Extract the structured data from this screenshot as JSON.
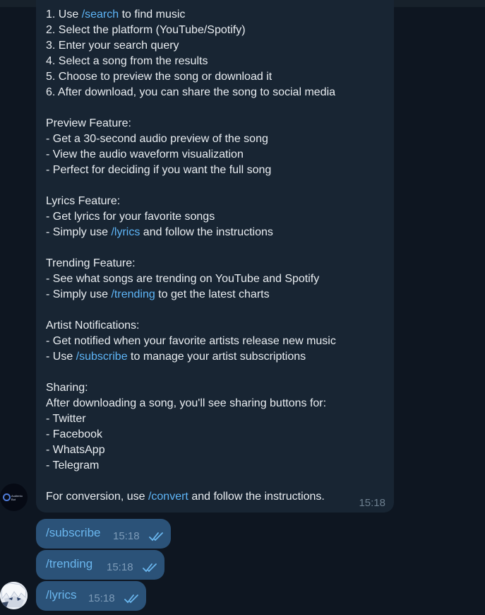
{
  "bot_message": {
    "lines": [
      {
        "type": "text",
        "parts": [
          {
            "t": "1. Use "
          },
          {
            "t": "/search",
            "cmd": true
          },
          {
            "t": " to find music"
          }
        ]
      },
      {
        "type": "text",
        "parts": [
          {
            "t": "2. Select the platform (YouTube/Spotify)"
          }
        ]
      },
      {
        "type": "text",
        "parts": [
          {
            "t": "3. Enter your search query"
          }
        ]
      },
      {
        "type": "text",
        "parts": [
          {
            "t": "4. Select a song from the results"
          }
        ]
      },
      {
        "type": "text",
        "parts": [
          {
            "t": "5. Choose to preview the song or download it"
          }
        ]
      },
      {
        "type": "text",
        "parts": [
          {
            "t": "6. After download, you can share the song to social media"
          }
        ]
      },
      {
        "type": "gap"
      },
      {
        "type": "heading",
        "parts": [
          {
            "t": "Preview Feature:"
          }
        ]
      },
      {
        "type": "text",
        "parts": [
          {
            "t": "- Get a 30-second audio preview of the song"
          }
        ]
      },
      {
        "type": "text",
        "parts": [
          {
            "t": "- View the audio waveform visualization"
          }
        ]
      },
      {
        "type": "text",
        "parts": [
          {
            "t": "- Perfect for deciding if you want the full song"
          }
        ]
      },
      {
        "type": "gap"
      },
      {
        "type": "heading",
        "parts": [
          {
            "t": "Lyrics Feature:"
          }
        ]
      },
      {
        "type": "text",
        "parts": [
          {
            "t": "- Get lyrics for your favorite songs"
          }
        ]
      },
      {
        "type": "text",
        "parts": [
          {
            "t": "- Simply use "
          },
          {
            "t": "/lyrics",
            "cmd": true
          },
          {
            "t": " and follow the instructions"
          }
        ]
      },
      {
        "type": "gap"
      },
      {
        "type": "heading",
        "parts": [
          {
            "t": "Trending Feature:"
          }
        ]
      },
      {
        "type": "text",
        "parts": [
          {
            "t": "- See what songs are trending on YouTube and Spotify"
          }
        ]
      },
      {
        "type": "text",
        "parts": [
          {
            "t": "- Simply use "
          },
          {
            "t": "/trending",
            "cmd": true
          },
          {
            "t": " to get the latest charts"
          }
        ]
      },
      {
        "type": "gap"
      },
      {
        "type": "heading",
        "parts": [
          {
            "t": "Artist Notifications:"
          }
        ]
      },
      {
        "type": "text",
        "parts": [
          {
            "t": "- Get notified when your favorite artists release new music"
          }
        ]
      },
      {
        "type": "text",
        "parts": [
          {
            "t": "- Use "
          },
          {
            "t": "/subscribe",
            "cmd": true
          },
          {
            "t": " to manage your artist subscriptions"
          }
        ]
      },
      {
        "type": "gap"
      },
      {
        "type": "heading",
        "parts": [
          {
            "t": "Sharing:"
          }
        ]
      },
      {
        "type": "text",
        "parts": [
          {
            "t": "After downloading a song, you'll see sharing buttons for:"
          }
        ]
      },
      {
        "type": "text",
        "parts": [
          {
            "t": "- Twitter"
          }
        ]
      },
      {
        "type": "text",
        "parts": [
          {
            "t": "- Facebook"
          }
        ]
      },
      {
        "type": "text",
        "parts": [
          {
            "t": "- WhatsApp"
          }
        ]
      },
      {
        "type": "text",
        "parts": [
          {
            "t": "- Telegram"
          }
        ]
      },
      {
        "type": "gap"
      },
      {
        "type": "text",
        "parts": [
          {
            "t": "For conversion, use "
          },
          {
            "t": "/convert",
            "cmd": true
          },
          {
            "t": " and follow the instructions."
          }
        ]
      }
    ],
    "time": "15:18"
  },
  "bot_avatar": {
    "brand_text": "Audiento Bot",
    "icon": "bot-logo-icon"
  },
  "user_messages": [
    {
      "text": "/subscribe",
      "time": "15:18",
      "status_icon": "double-check-icon"
    },
    {
      "text": "/trending",
      "time": "15:18",
      "status_icon": "double-check-icon"
    },
    {
      "text": "/lyrics",
      "time": "15:18",
      "status_icon": "double-check-icon"
    }
  ],
  "user_avatar": {
    "icon": "anime-character-avatar-icon"
  },
  "colors": {
    "background": "#0e1621",
    "incoming_bubble": "#182533",
    "outgoing_bubble": "#2b5278",
    "command_link": "#5eb5f7",
    "text": "#e9edf1"
  }
}
